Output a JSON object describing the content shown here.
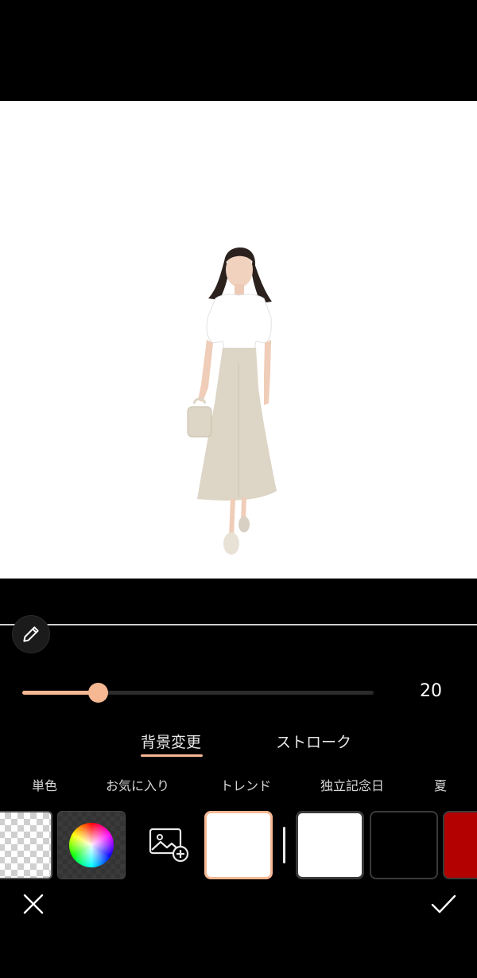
{
  "editor": {
    "stroke_width_value": "20",
    "stroke_slider_fraction": 0.216
  },
  "tabs": [
    {
      "label": "背景変更",
      "active": true
    },
    {
      "label": "ストローク",
      "active": false
    }
  ],
  "categories": [
    "単色",
    "お気に入り",
    "トレンド",
    "独立記念日",
    "夏"
  ],
  "swatches": {
    "transparent": "transparent",
    "color_picker": "color-wheel",
    "image": "add-image-icon",
    "selected": "#ffffff",
    "colors": [
      "#ffffff",
      "#000000",
      "#b30000"
    ]
  },
  "accent_color": "#f6b893",
  "icons": {
    "edit": "pencil-icon",
    "cancel": "close-icon",
    "confirm": "check-icon"
  }
}
